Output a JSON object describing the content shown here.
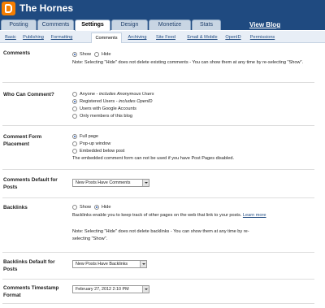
{
  "header": {
    "blog_title": "The Hornes",
    "view_blog": "View Blog",
    "tabs": [
      {
        "label": "Posting"
      },
      {
        "label": "Comments"
      },
      {
        "label": "Settings"
      },
      {
        "label": "Design"
      },
      {
        "label": "Monetize"
      },
      {
        "label": "Stats"
      }
    ]
  },
  "subnav": {
    "items": [
      {
        "label": "Basic"
      },
      {
        "label": "Publishing"
      },
      {
        "label": "Formatting"
      },
      {
        "label": "Comments"
      },
      {
        "label": "Archiving"
      },
      {
        "label": "Site Feed"
      },
      {
        "label": "Email & Mobile"
      },
      {
        "label": "OpenID"
      },
      {
        "label": "Permissions"
      }
    ]
  },
  "comments": {
    "label": "Comments",
    "show": "Show",
    "hide": "Hide",
    "note": "Note: Selecting \"Hide\" does not delete existing comments - You can show them at any time by re-selecting \"Show\"."
  },
  "who": {
    "label": "Who Can Comment?",
    "options": [
      {
        "text": "Anyone - ",
        "extra": "includes Anonymous Users"
      },
      {
        "text": "Registered Users - ",
        "extra": "includes OpenID"
      },
      {
        "text": "Users with Google Accounts",
        "extra": ""
      },
      {
        "text": "Only members of this blog",
        "extra": ""
      }
    ]
  },
  "placement": {
    "label": "Comment Form Placement",
    "options": [
      "Full page",
      "Pop-up window",
      "Embedded below post"
    ],
    "note": "The embedded comment form can not be used if you have Post Pages disabled."
  },
  "default_posts": {
    "label": "Comments Default for Posts",
    "value": "New Posts Have Comments"
  },
  "backlinks": {
    "label": "Backlinks",
    "show": "Show",
    "hide": "Hide",
    "desc": "Backlinks enable you to keep track of other pages on the web that link to your posts.",
    "learn_more": "Learn more",
    "note": "Note: Selecting \"Hide\" does not delete backlinks - You can show them at any time by re-selecting \"Show\"."
  },
  "backlinks_default": {
    "label": "Backlinks Default for Posts",
    "value": "New Posts Have Backlinks"
  },
  "timestamp": {
    "label": "Comments Timestamp Format",
    "value": "February 27, 2012 2:10 PM"
  }
}
